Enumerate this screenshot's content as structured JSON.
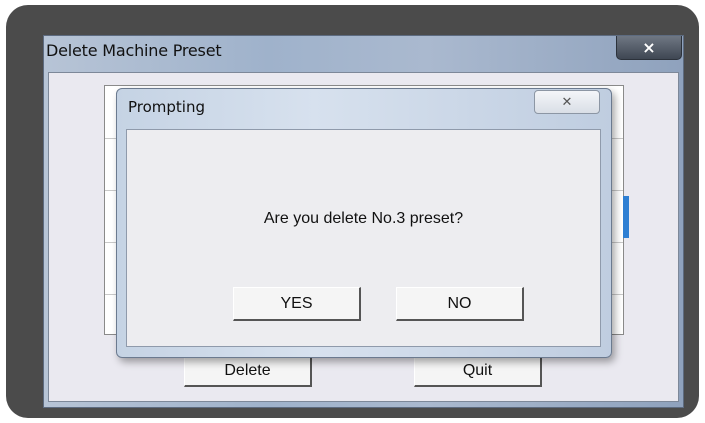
{
  "outer_window": {
    "title": "Delete Machine Preset",
    "close_icon": "×",
    "delete_label": "Delete",
    "quit_label": "Quit"
  },
  "dialog": {
    "title": "Prompting",
    "close_icon": "✕",
    "message": "Are you delete No.3 preset?",
    "yes_label": "YES",
    "no_label": "NO"
  },
  "colors": {
    "frame": "#4b4b4b",
    "selection_accent": "#2e7fd3",
    "dialog_body": "#ededf0"
  }
}
